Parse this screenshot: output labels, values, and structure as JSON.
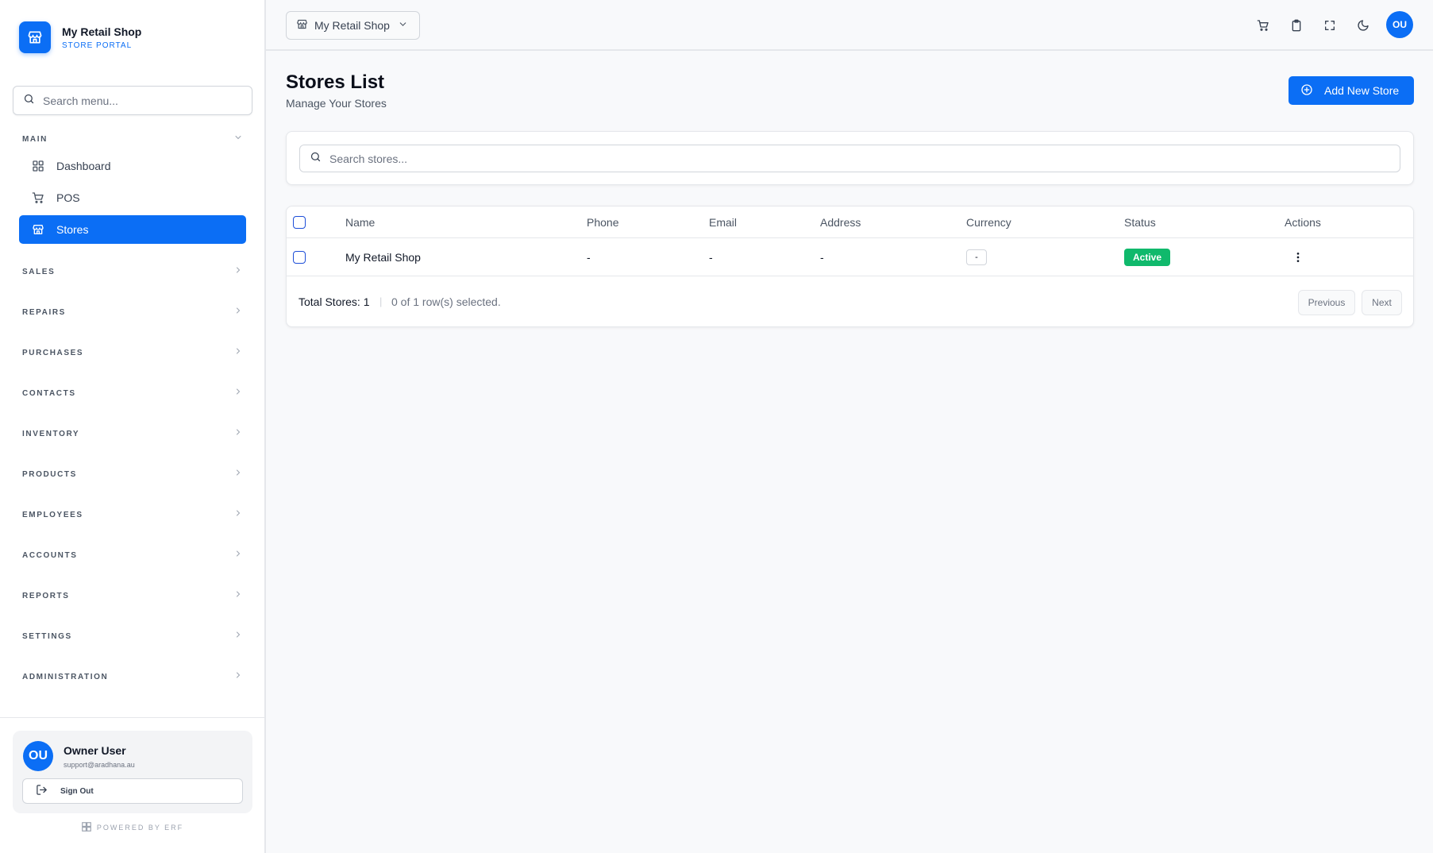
{
  "brand": {
    "name": "My Retail Shop",
    "subtitle": "STORE PORTAL"
  },
  "menu_search": {
    "placeholder": "Search menu..."
  },
  "sidebar": {
    "main_label": "MAIN",
    "main_items": [
      {
        "label": "Dashboard",
        "icon": "grid-icon"
      },
      {
        "label": "POS",
        "icon": "cart-icon"
      },
      {
        "label": "Stores",
        "icon": "store-icon",
        "active": true
      }
    ],
    "sections": [
      "SALES",
      "REPAIRS",
      "PURCHASES",
      "CONTACTS",
      "INVENTORY",
      "PRODUCTS",
      "EMPLOYEES",
      "ACCOUNTS",
      "REPORTS",
      "SETTINGS",
      "ADMINISTRATION"
    ]
  },
  "user": {
    "initials": "OU",
    "name": "Owner User",
    "email": "support@aradhana.au",
    "signout_label": "Sign Out"
  },
  "powered_by": "POWERED BY ERF",
  "topbar": {
    "store_select": "My Retail Shop",
    "icons": [
      "cart-icon",
      "clipboard-icon",
      "fullscreen-icon",
      "moon-icon"
    ],
    "avatar_initials": "OU"
  },
  "page": {
    "title": "Stores List",
    "subtitle": "Manage Your Stores",
    "add_button": "Add New Store"
  },
  "store_search": {
    "placeholder": "Search stores..."
  },
  "table": {
    "columns": [
      "Name",
      "Phone",
      "Email",
      "Address",
      "Currency",
      "Status",
      "Actions"
    ],
    "rows": [
      {
        "name": "My Retail Shop",
        "phone": "-",
        "email": "-",
        "address": "-",
        "currency": "-",
        "status": "Active"
      }
    ]
  },
  "footer": {
    "total_label": "Total Stores:",
    "total_value": "1",
    "separator": "|",
    "selected_text": "0 of 1 row(s) selected.",
    "previous": "Previous",
    "next": "Next"
  },
  "colors": {
    "accent": "#0b6ef5",
    "status_active": "#10b96c"
  }
}
